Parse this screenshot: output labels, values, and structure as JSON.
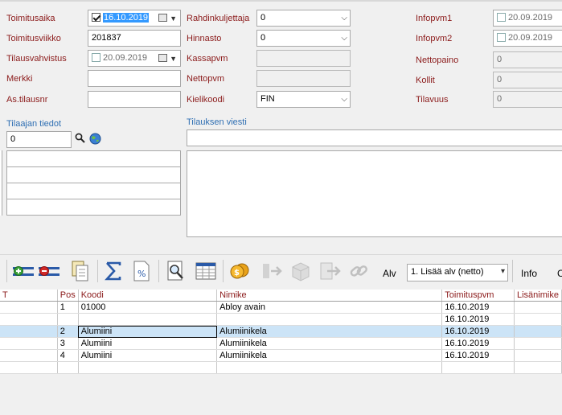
{
  "delivery": {
    "toimitusaika_label": "Toimitusaika",
    "toimitusaika_value": "16.10.2019",
    "toimitusviikko_label": "Toimitusviikko",
    "toimitusviikko_value": "201837",
    "tilausvahvistus_label": "Tilausvahvistus",
    "tilausvahvistus_value": "20.09.2019",
    "merkki_label": "Merkki",
    "merkki_value": "",
    "astilausnr_label": "As.tilausnr",
    "astilausnr_value": ""
  },
  "mid": {
    "rahdinkuljettaja_label": "Rahdinkuljettaja",
    "rahdinkuljettaja_value": "0",
    "hinnasto_label": "Hinnasto",
    "hinnasto_value": "0",
    "kassapvm_label": "Kassapvm",
    "kassapvm_value": "",
    "nettopvm_label": "Nettopvm",
    "nettopvm_value": "",
    "kielikoodi_label": "Kielikoodi",
    "kielikoodi_value": "FIN"
  },
  "right": {
    "infopvm1_label": "Infopvm1",
    "infopvm1_value": "20.09.2019",
    "infopvm2_label": "Infopvm2",
    "infopvm2_value": "20.09.2019",
    "nettopaino_label": "Nettopaino",
    "nettopaino_value": "0",
    "kollit_label": "Kollit",
    "kollit_value": "0",
    "tilavuus_label": "Tilavuus",
    "tilavuus_value": "0"
  },
  "customer": {
    "title": "Tilaajan tiedot",
    "search_value": "0"
  },
  "message": {
    "title": "Tilauksen viesti",
    "value": ""
  },
  "toolbar": {
    "alv_label": "Alv",
    "alv_option": "1. Lisää alv (netto)",
    "info_label": "Info",
    "cut_label": "C"
  },
  "grid": {
    "headers": [
      "T",
      "Pos",
      "Koodi",
      "Nimike",
      "Toimituspvm",
      "Lisänimike"
    ],
    "rows": [
      [
        "",
        "1",
        "01000",
        "Abloy avain",
        "16.10.2019",
        ""
      ],
      [
        "",
        "",
        "",
        "",
        "16.10.2019",
        ""
      ],
      [
        "",
        "2",
        "Alumiini",
        "Alumiinikela",
        "16.10.2019",
        ""
      ],
      [
        "",
        "3",
        "Alumiini",
        "Alumiinikela",
        "16.10.2019",
        ""
      ],
      [
        "",
        "4",
        "Alumiini",
        "Alumiinikela",
        "16.10.2019",
        ""
      ],
      [
        "",
        "",
        "",
        "",
        "",
        ""
      ]
    ]
  },
  "colors": {
    "label": "#8b1a1a",
    "section_title": "#2f6fb3",
    "selection": "#3399ff",
    "selected_row": "#cce4f7"
  }
}
